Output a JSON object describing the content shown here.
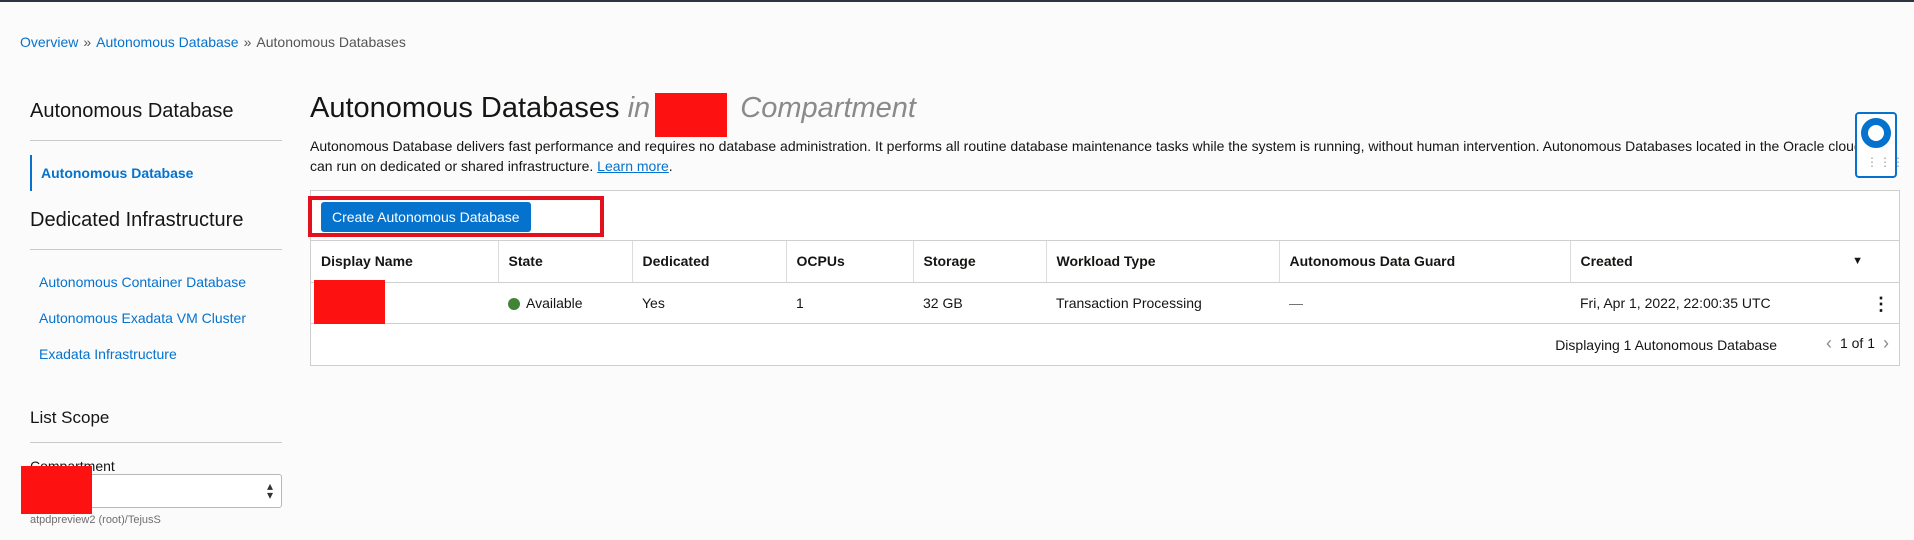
{
  "breadcrumb": {
    "items": [
      "Overview",
      "Autonomous Database"
    ],
    "current": "Autonomous Databases",
    "separator": "»"
  },
  "sidebar": {
    "heading": "Autonomous Database",
    "active_item": "Autonomous Database",
    "dedicated_heading": "Dedicated Infrastructure",
    "dedicated_items": [
      "Autonomous Container Database",
      "Autonomous Exadata VM Cluster",
      "Exadata Infrastructure"
    ],
    "list_scope_heading": "List Scope",
    "compartment_label": "Compartment",
    "compartment_value": "",
    "compartment_path": "atpdpreview2 (root)/TejusS"
  },
  "main": {
    "title": "Autonomous Databases",
    "title_in": "in",
    "title_compartment_suffix": "Compartment",
    "description": "Autonomous Database delivers fast performance and requires no database administration. It performs all routine database maintenance tasks while the system is running, without human intervention. Autonomous Databases located in the Oracle cloud",
    "description_line2": "can run on dedicated or shared infrastructure.",
    "learn_more": "Learn more",
    "learn_more_trailing": ".",
    "create_button": "Create Autonomous Database"
  },
  "table": {
    "columns": [
      "Display Name",
      "State",
      "Dedicated",
      "OCPUs",
      "Storage",
      "Workload Type",
      "Autonomous Data Guard",
      "Created"
    ],
    "rows": [
      {
        "display_name": "",
        "state": "Available",
        "dedicated": "Yes",
        "ocpus": "1",
        "storage": "32 GB",
        "workload_type": "Transaction Processing",
        "data_guard": "—",
        "created": "Fri, Apr 1, 2022, 22:00:35 UTC"
      }
    ],
    "footer_count": "Displaying 1 Autonomous Database",
    "page_indicator": "1 of 1"
  },
  "colors": {
    "accent": "#0572ce",
    "status_available": "#418436",
    "highlight_box": "#e3101d",
    "redaction": "#fe1111"
  },
  "icons": {
    "sort": "caret-down-icon",
    "row_actions": "kebab-menu-icon",
    "prev_page": "chevron-left-icon",
    "next_page": "chevron-right-icon",
    "help": "life-ring-icon",
    "select": "up-down-caret-icon"
  }
}
